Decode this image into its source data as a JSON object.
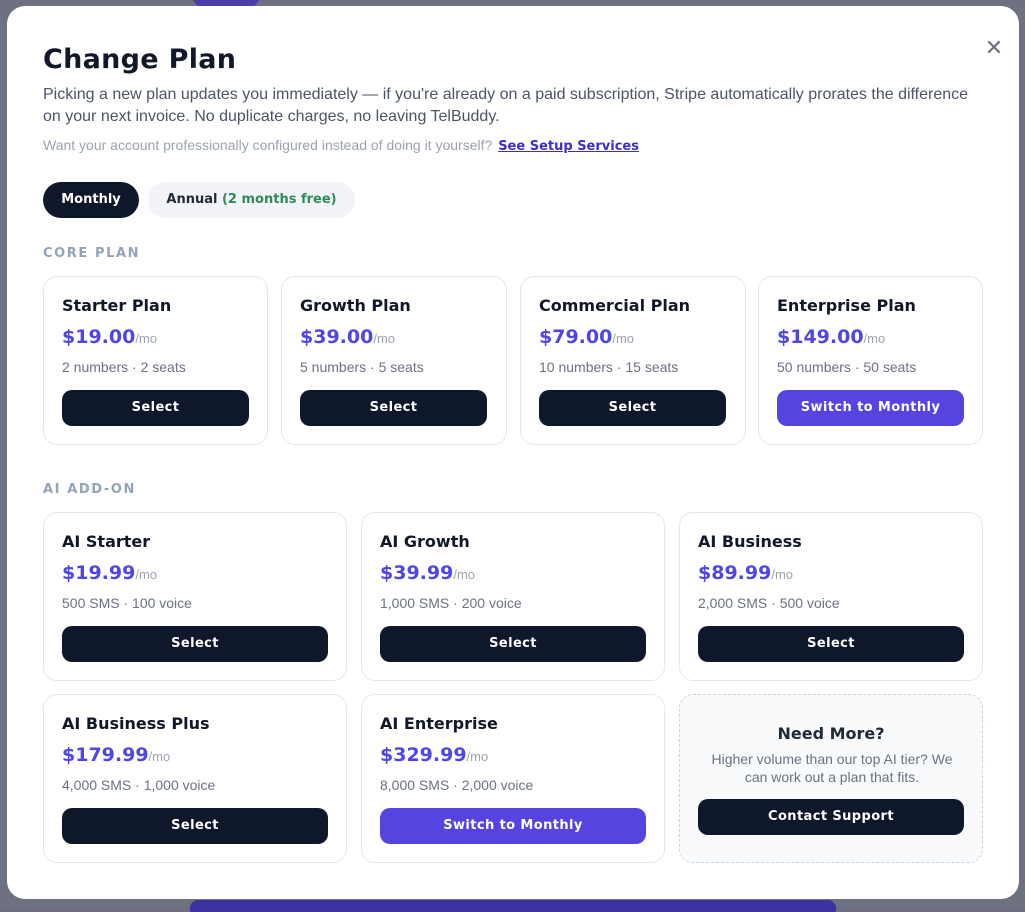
{
  "modal": {
    "title": "Change Plan",
    "close_icon": "close-icon",
    "close_glyph": "✕",
    "description": "Picking a new plan updates you immediately — if you're already on a paid subscription, Stripe automatically prorates the difference on your next invoice. No duplicate charges, no leaving TelBuddy.",
    "setup_prompt": "Want your account professionally configured instead of doing it yourself?",
    "setup_link": "See Setup Services"
  },
  "billing_toggle": {
    "monthly_label": "Monthly",
    "annual_label": "Annual",
    "annual_bonus": "(2 months free)",
    "selected": "Monthly"
  },
  "core_section": {
    "label": "CORE PLAN",
    "plans": [
      {
        "name": "Starter Plan",
        "price": "$19.00",
        "per": "/mo",
        "meta": "2 numbers · 2 seats",
        "button": "Select"
      },
      {
        "name": "Growth Plan",
        "price": "$39.00",
        "per": "/mo",
        "meta": "5 numbers · 5 seats",
        "button": "Select"
      },
      {
        "name": "Commercial Plan",
        "price": "$79.00",
        "per": "/mo",
        "meta": "10 numbers · 15 seats",
        "button": "Select"
      },
      {
        "name": "Enterprise Plan",
        "price": "$149.00",
        "per": "/mo",
        "meta": "50 numbers · 50 seats",
        "button": "Switch to Monthly"
      }
    ]
  },
  "ai_section": {
    "label": "AI ADD-ON",
    "plans": [
      {
        "name": "AI Starter",
        "price": "$19.99",
        "per": "/mo",
        "meta": "500 SMS · 100 voice",
        "button": "Select"
      },
      {
        "name": "AI Growth",
        "price": "$39.99",
        "per": "/mo",
        "meta": "1,000 SMS · 200 voice",
        "button": "Select"
      },
      {
        "name": "AI Business",
        "price": "$89.99",
        "per": "/mo",
        "meta": "2,000 SMS · 500 voice",
        "button": "Select"
      },
      {
        "name": "AI Business Plus",
        "price": "$179.99",
        "per": "/mo",
        "meta": "4,000 SMS · 1,000 voice",
        "button": "Select"
      },
      {
        "name": "AI Enterprise",
        "price": "$329.99",
        "per": "/mo",
        "meta": "8,000 SMS · 2,000 voice",
        "button": "Switch to Monthly"
      }
    ],
    "need_more": {
      "title": "Need More?",
      "text": "Higher volume than our top AI tier? We can work out a plan that fits.",
      "button": "Contact Support"
    }
  },
  "colors": {
    "accent": "#5544e0",
    "price": "#4f46e5",
    "dark_button": "#0f172a",
    "free_green": "#2f8a55"
  }
}
